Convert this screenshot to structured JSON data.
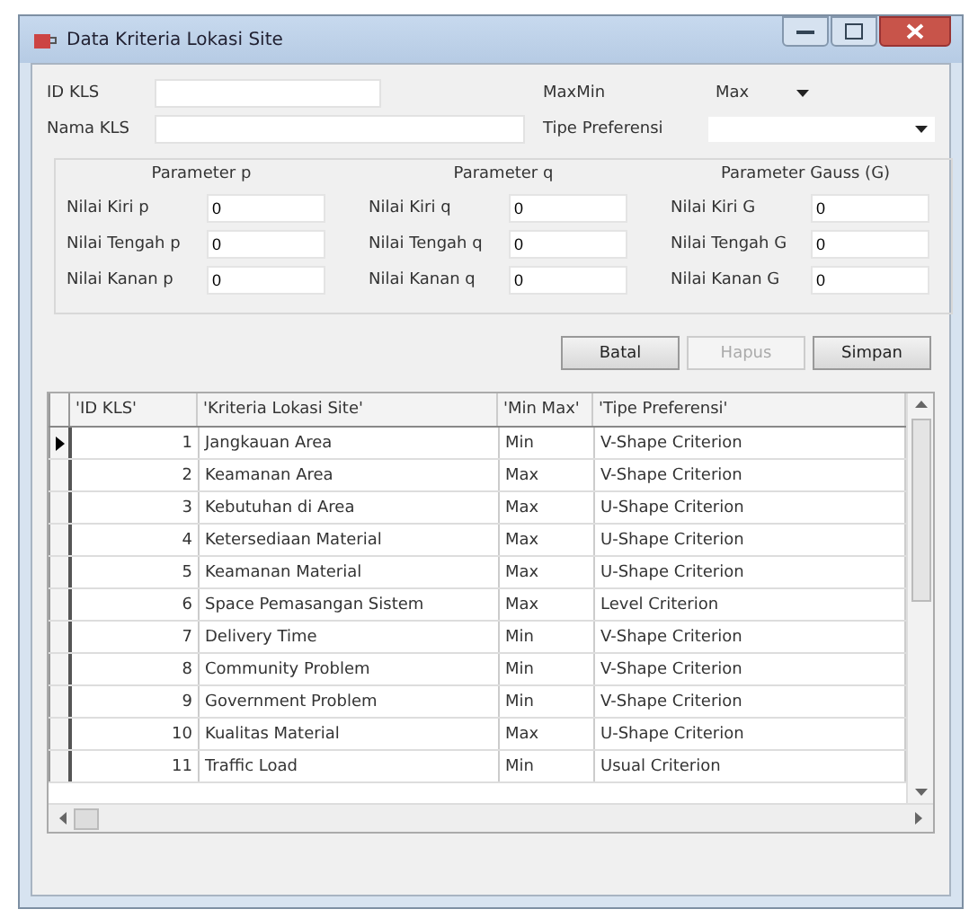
{
  "window": {
    "title": "Data Kriteria Lokasi Site"
  },
  "form": {
    "id_label": "ID KLS",
    "name_label": "Nama KLS",
    "maxmin_label": "MaxMin",
    "maxmin_value": "Max",
    "tipe_label": "Tipe Preferensi"
  },
  "parameter_groups": [
    {
      "title": "Parameter p",
      "fields": [
        {
          "label": "Nilai Kiri p",
          "value": "0"
        },
        {
          "label": "Nilai Tengah p",
          "value": "0"
        },
        {
          "label": "Nilai Kanan p",
          "value": "0"
        }
      ]
    },
    {
      "title": "Parameter q",
      "fields": [
        {
          "label": "Nilai Kiri q",
          "value": "0"
        },
        {
          "label": "Nilai Tengah q",
          "value": "0"
        },
        {
          "label": "Nilai Kanan q",
          "value": "0"
        }
      ]
    },
    {
      "title": "Parameter Gauss (G)",
      "fields": [
        {
          "label": "Nilai Kiri G",
          "value": "0"
        },
        {
          "label": "Nilai Tengah G",
          "value": "0"
        },
        {
          "label": "Nilai Kanan G",
          "value": "0"
        }
      ]
    }
  ],
  "buttons": [
    {
      "label": "Batal",
      "disabled": false
    },
    {
      "label": "Hapus",
      "disabled": true
    },
    {
      "label": "Simpan",
      "disabled": false
    }
  ],
  "table": {
    "columns": [
      "'ID KLS'",
      "'Kriteria Lokasi Site'",
      "'Min Max'",
      "'Tipe Preferensi'"
    ],
    "rows": [
      {
        "cells": [
          "1",
          "Jangkauan Area",
          "Min",
          "V-Shape Criterion"
        ],
        "selected": true
      },
      {
        "cells": [
          "2",
          "Keamanan Area",
          "Max",
          "V-Shape Criterion"
        ],
        "selected": false
      },
      {
        "cells": [
          "3",
          "Kebutuhan di Area",
          "Max",
          "U-Shape Criterion"
        ],
        "selected": false
      },
      {
        "cells": [
          "4",
          "Ketersediaan Material",
          "Max",
          "U-Shape Criterion"
        ],
        "selected": false
      },
      {
        "cells": [
          "5",
          "Keamanan Material",
          "Max",
          "U-Shape Criterion"
        ],
        "selected": false
      },
      {
        "cells": [
          "6",
          "Space Pemasangan Sistem",
          "Max",
          "Level Criterion"
        ],
        "selected": false
      },
      {
        "cells": [
          "7",
          "Delivery Time",
          "Min",
          "V-Shape Criterion"
        ],
        "selected": false
      },
      {
        "cells": [
          "8",
          "Community Problem",
          "Min",
          "V-Shape Criterion"
        ],
        "selected": false
      },
      {
        "cells": [
          "9",
          "Government Problem",
          "Min",
          "V-Shape Criterion"
        ],
        "selected": false
      },
      {
        "cells": [
          "10",
          "Kualitas Material",
          "Max",
          "U-Shape Criterion"
        ],
        "selected": false
      },
      {
        "cells": [
          "11",
          "Traffic Load",
          "Min",
          "Usual Criterion"
        ],
        "selected": false
      }
    ]
  }
}
